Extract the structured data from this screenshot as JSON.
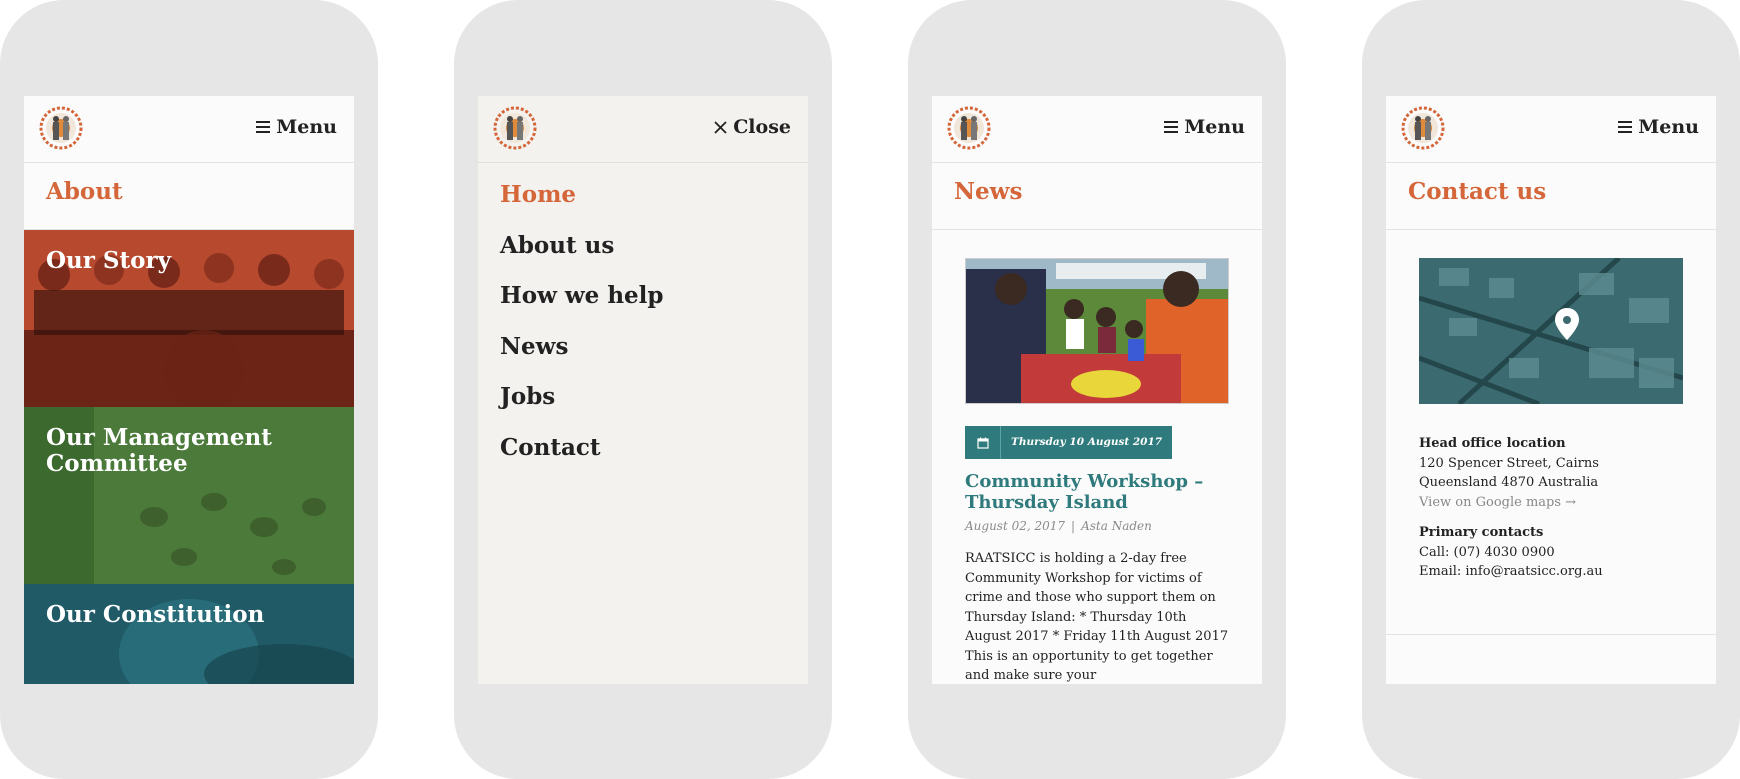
{
  "header": {
    "menu_label": "Menu",
    "close_label": "Close"
  },
  "about": {
    "title": "About",
    "tiles": [
      {
        "label": "Our Story",
        "color": "#b6492e"
      },
      {
        "label": "Our Management Committee",
        "color": "#4b7a3a"
      },
      {
        "label": "Our Constitution",
        "color": "#1f5a66"
      }
    ]
  },
  "menu": {
    "items": [
      {
        "label": "Home",
        "active": true
      },
      {
        "label": "About us",
        "active": false
      },
      {
        "label": "How we help",
        "active": false
      },
      {
        "label": "News",
        "active": false
      },
      {
        "label": "Jobs",
        "active": false
      },
      {
        "label": "Contact",
        "active": false
      }
    ]
  },
  "news": {
    "title": "News",
    "date_badge": "Thursday 10 August 2017",
    "article_title": "Community Workshop – Thursday Island",
    "date": "August 02, 2017",
    "separator": "|",
    "author": "Asta Naden",
    "excerpt": "RAATSICC is holding a 2-day free Community Workshop for victims of crime and those who support them on Thursday Island: * Thursday 10th August 2017 * Friday 11th August 2017 This is an opportunity to get together and make sure your"
  },
  "contact": {
    "title": "Contact us",
    "head_office_heading": "Head office location",
    "address_line1": "120 Spencer Street, Cairns",
    "address_line2": "Queensland 4870 Australia",
    "maps_link": "View on Google maps →",
    "primary_heading": "Primary contacts",
    "phone": "Call: (07) 4030 0900",
    "email": "Email: info@raatsicc.org.au"
  },
  "colors": {
    "accent": "#d4663a",
    "teal": "#2f7a7c",
    "phone_frame": "#e6e6e6"
  }
}
